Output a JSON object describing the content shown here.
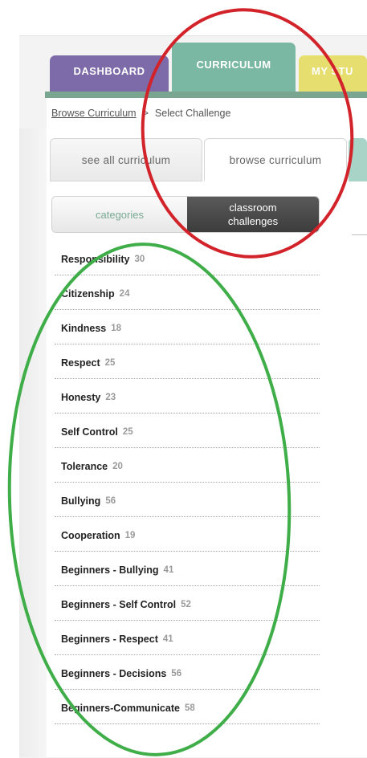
{
  "nav_tabs": [
    {
      "label": "DASHBOARD",
      "color": "#7d6aa9"
    },
    {
      "label": "CURRICULUM",
      "color": "#7bb8a3"
    },
    {
      "label": "MY STU",
      "color": "#e6de6f"
    }
  ],
  "breadcrumb": {
    "link": "Browse Curriculum",
    "separator": ">",
    "current": "Select Challenge"
  },
  "subtabs": [
    {
      "label": "see all curriculum"
    },
    {
      "label": "browse curriculum"
    }
  ],
  "toggle": {
    "categories_label": "categories",
    "challenges_line1": "classroom",
    "challenges_line2": "challenges"
  },
  "categories": [
    {
      "name": "Responsibility",
      "count": "30"
    },
    {
      "name": "Citizenship",
      "count": "24"
    },
    {
      "name": "Kindness",
      "count": "18"
    },
    {
      "name": "Respect",
      "count": "25"
    },
    {
      "name": "Honesty",
      "count": "23"
    },
    {
      "name": "Self Control",
      "count": "25"
    },
    {
      "name": "Tolerance",
      "count": "20"
    },
    {
      "name": "Bullying",
      "count": "56"
    },
    {
      "name": "Cooperation",
      "count": "19"
    },
    {
      "name": "Beginners - Bullying",
      "count": "41"
    },
    {
      "name": "Beginners - Self Control",
      "count": "52"
    },
    {
      "name": "Beginners - Respect",
      "count": "41"
    },
    {
      "name": "Beginners - Decisions",
      "count": "56"
    },
    {
      "name": "Beginners-Communicate",
      "count": "58"
    }
  ],
  "colors": {
    "annotation_red": "#d3232a",
    "annotation_green": "#3fae49"
  }
}
